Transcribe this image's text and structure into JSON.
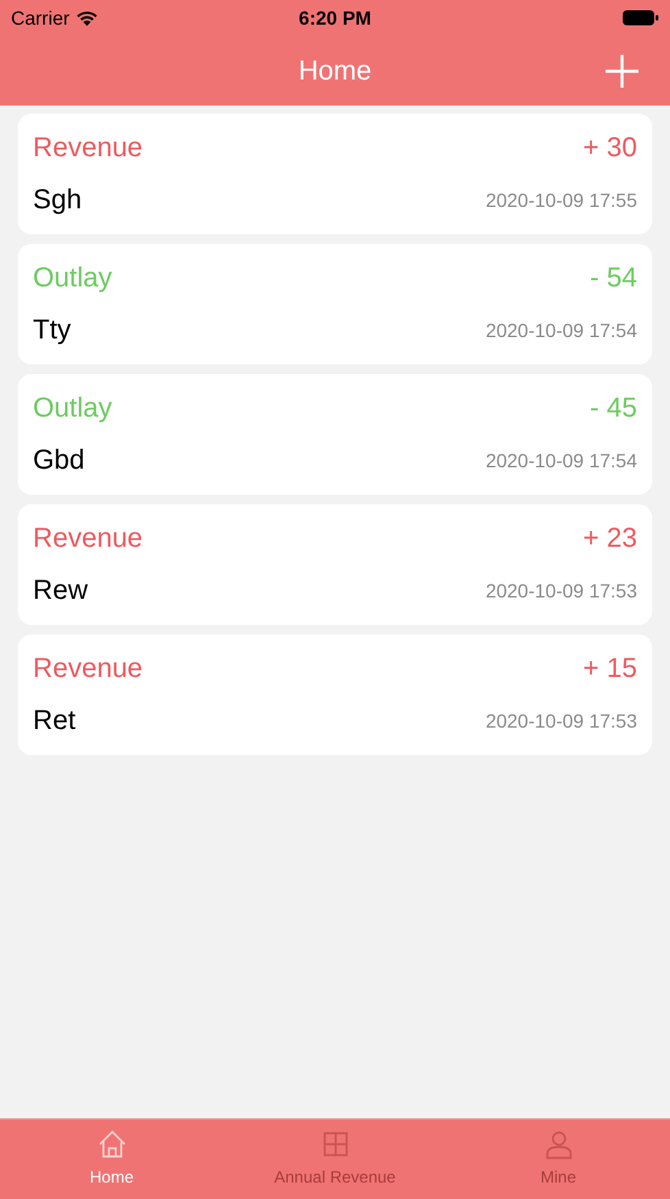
{
  "status_bar": {
    "carrier": "Carrier",
    "time": "6:20 PM"
  },
  "nav_bar": {
    "title": "Home"
  },
  "records": [
    {
      "kind": "revenue",
      "type": "Revenue",
      "amount": "+ 30",
      "name": "Sgh",
      "time": "2020-10-09 17:55"
    },
    {
      "kind": "outlay",
      "type": "Outlay",
      "amount": "- 54",
      "name": "Tty",
      "time": "2020-10-09 17:54"
    },
    {
      "kind": "outlay",
      "type": "Outlay",
      "amount": "- 45",
      "name": "Gbd",
      "time": "2020-10-09 17:54"
    },
    {
      "kind": "revenue",
      "type": "Revenue",
      "amount": "+ 23",
      "name": "Rew",
      "time": "2020-10-09 17:53"
    },
    {
      "kind": "revenue",
      "type": "Revenue",
      "amount": "+ 15",
      "name": "Ret",
      "time": "2020-10-09 17:53"
    }
  ],
  "tab_bar": [
    {
      "kind": "home",
      "label": "Home",
      "selected": true
    },
    {
      "kind": "grid",
      "label": "Annual Revenue",
      "selected": false
    },
    {
      "kind": "person",
      "label": "Mine",
      "selected": false
    }
  ]
}
